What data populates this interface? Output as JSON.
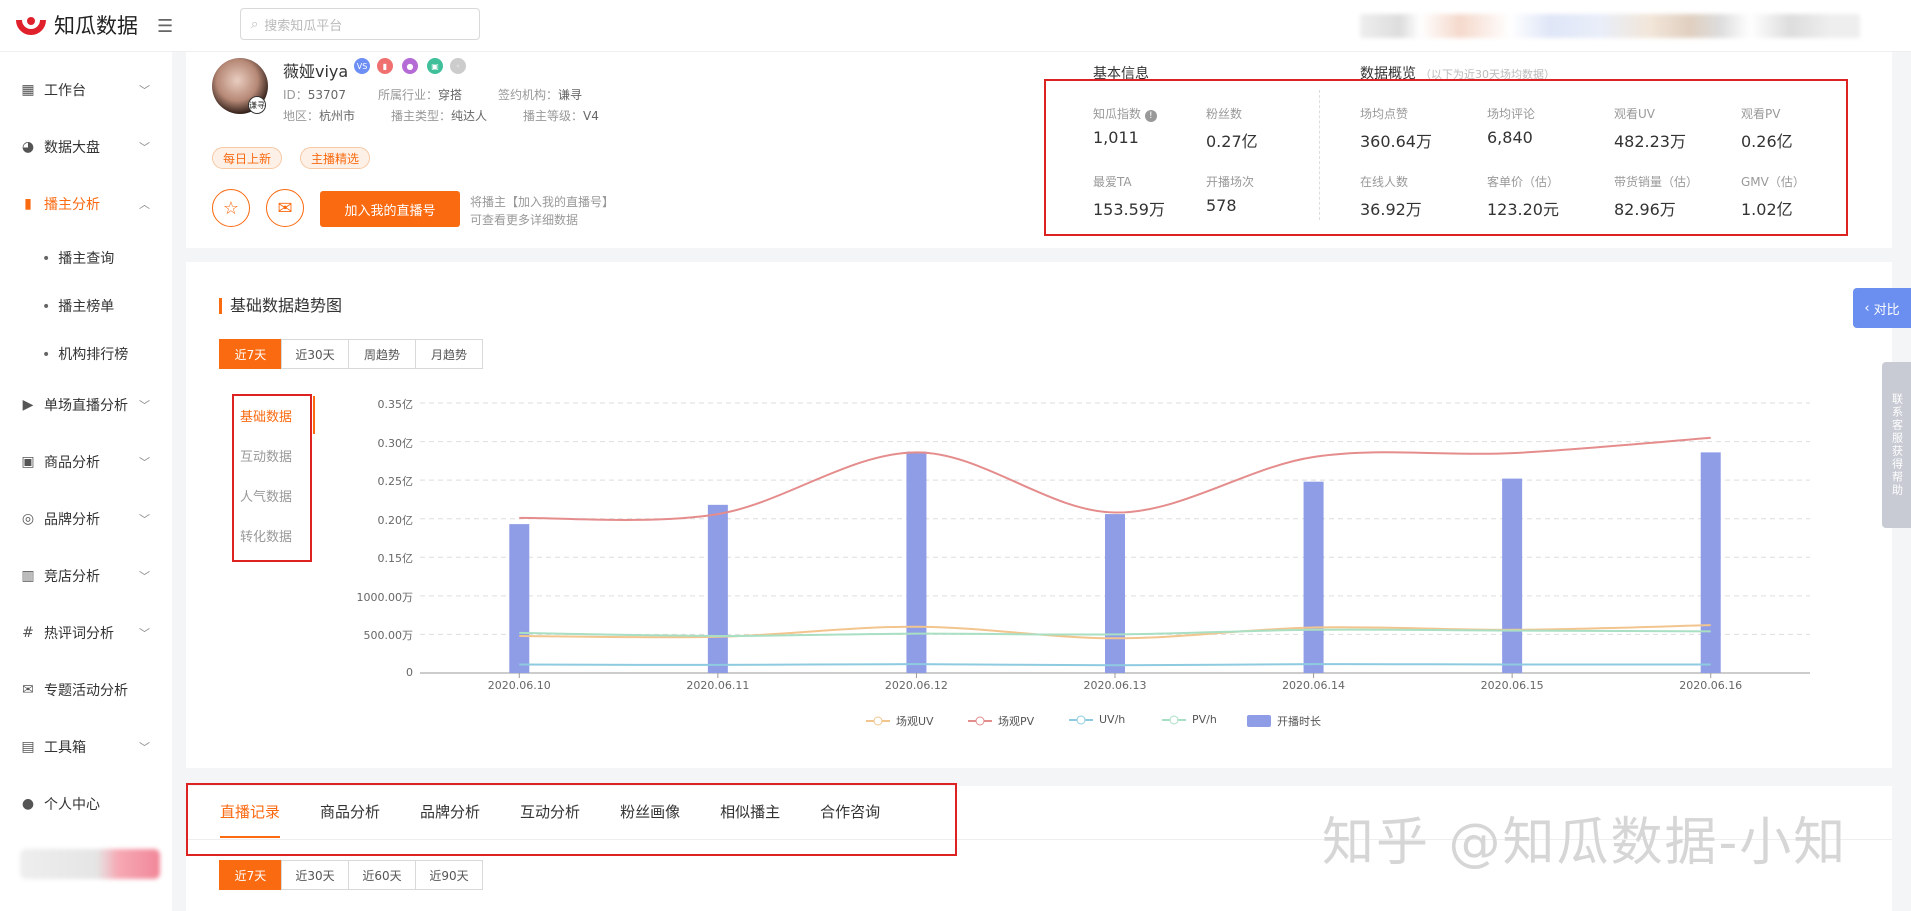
{
  "app": {
    "name": "知瓜数据",
    "search_placeholder": "搜索知瓜平台"
  },
  "sidebar": {
    "items": [
      {
        "label": "工作台",
        "icon": "grid-icon"
      },
      {
        "label": "数据大盘",
        "icon": "pie-icon"
      },
      {
        "label": "播主分析",
        "icon": "bar-chart-icon",
        "active": true
      },
      {
        "label": "单场直播分析",
        "icon": "live-icon"
      },
      {
        "label": "商品分析",
        "icon": "goods-icon"
      },
      {
        "label": "品牌分析",
        "icon": "brand-icon"
      },
      {
        "label": "竞店分析",
        "icon": "shop-icon"
      },
      {
        "label": "热评词分析",
        "icon": "hash-icon"
      },
      {
        "label": "专题活动分析",
        "icon": "topic-icon"
      },
      {
        "label": "工具箱",
        "icon": "toolbox-icon"
      },
      {
        "label": "个人中心",
        "icon": "user-icon"
      }
    ],
    "subitems": [
      "播主查询",
      "播主榜单",
      "机构排行榜"
    ]
  },
  "profile": {
    "name": "薇娅viya",
    "id_label": "ID：",
    "id": "53707",
    "industry_label": "所属行业：",
    "industry": "穿搭",
    "agency_label": "签约机构：",
    "agency": "谦寻",
    "region_label": "地区：",
    "region": "杭州市",
    "type_label": "播主类型：",
    "type": "纯达人",
    "level_label": "播主等级：",
    "level": "V4",
    "tags": [
      "每日上新",
      "主播精选"
    ],
    "add_button": "加入我的直播号",
    "hint_line1": "将播主【加入我的直播号】",
    "hint_line2": "可查看更多详细数据",
    "avatar_badge": "谦寻"
  },
  "basic_info": {
    "title": "基本信息",
    "stats": [
      {
        "label": "知瓜指数",
        "value": "1,011"
      },
      {
        "label": "粉丝数",
        "value": "0.27亿"
      },
      {
        "label": "最爱TA",
        "value": "153.59万"
      },
      {
        "label": "开播场次",
        "value": "578"
      }
    ]
  },
  "overview": {
    "title": "数据概览",
    "subtitle": "（以下为近30天场均数据）",
    "stats": [
      {
        "label": "场均点赞",
        "value": "360.64万"
      },
      {
        "label": "场均评论",
        "value": "6,840"
      },
      {
        "label": "观看UV",
        "value": "482.23万"
      },
      {
        "label": "观看PV",
        "value": "0.26亿"
      },
      {
        "label": "在线人数",
        "value": "36.92万"
      },
      {
        "label": "客单价（估）",
        "value": "123.20元"
      },
      {
        "label": "带货销量（估）",
        "value": "82.96万"
      },
      {
        "label": "GMV（估）",
        "value": "1.02亿"
      }
    ]
  },
  "trend": {
    "title": "基础数据趋势图",
    "ranges": [
      "近7天",
      "近30天",
      "周趋势",
      "月趋势"
    ],
    "side_tabs": [
      "基础数据",
      "互动数据",
      "人气数据",
      "转化数据"
    ]
  },
  "chart_data": {
    "type": "bar",
    "categories": [
      "2020.06.10",
      "2020.06.11",
      "2020.06.12",
      "2020.06.13",
      "2020.06.14",
      "2020.06.15",
      "2020.06.16"
    ],
    "y_ticks": [
      "0.35亿",
      "0.30亿",
      "0.25亿",
      "0.20亿",
      "0.15亿",
      "1000.00万",
      "500.00万",
      "0"
    ],
    "ylim": [
      0,
      3500
    ],
    "unit": "万",
    "series": [
      {
        "name": "场观UV",
        "kind": "line",
        "color": "#f3c58e",
        "values": [
          480,
          470,
          600,
          450,
          590,
          560,
          620
        ]
      },
      {
        "name": "场观PV",
        "kind": "line",
        "color": "#e58c8c",
        "values": [
          2010,
          2060,
          2860,
          2080,
          2800,
          2850,
          3050
        ]
      },
      {
        "name": "UV/h",
        "kind": "line",
        "color": "#8fcbe0",
        "values": [
          110,
          105,
          115,
          100,
          115,
          110,
          110
        ]
      },
      {
        "name": "PV/h",
        "kind": "line",
        "color": "#a9dfc3",
        "values": [
          520,
          480,
          510,
          500,
          560,
          550,
          540
        ]
      },
      {
        "name": "开播时长",
        "kind": "bar",
        "color": "#8f9de6",
        "values": [
          1930,
          2180,
          2870,
          2060,
          2480,
          2520,
          2860
        ]
      }
    ]
  },
  "bottom_tabs": [
    "直播记录",
    "商品分析",
    "品牌分析",
    "互动分析",
    "粉丝画像",
    "相似播主",
    "合作咨询"
  ],
  "bottom_ranges": [
    "近7天",
    "近30天",
    "近60天",
    "近90天"
  ],
  "floating": {
    "compare": "对比",
    "contact": "联系客服获得帮助"
  },
  "watermark": "知乎 @知瓜数据-小知",
  "colors": {
    "accent": "#fa6a10",
    "annotation": "#dd2222"
  }
}
